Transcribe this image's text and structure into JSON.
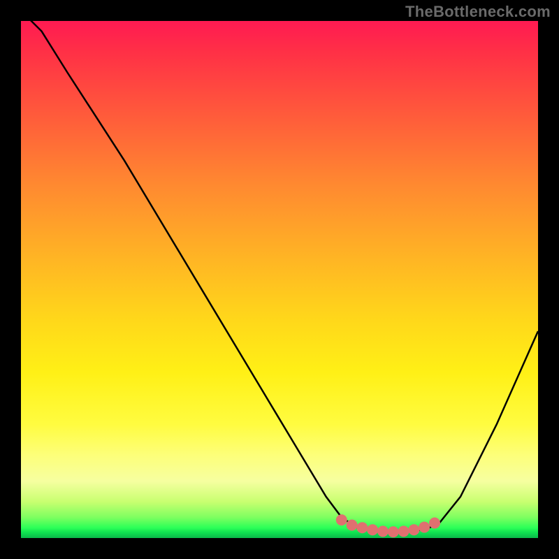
{
  "watermark": "TheBottleneck.com",
  "chart_data": {
    "type": "line",
    "title": "",
    "xlabel": "",
    "ylabel": "",
    "xlim": [
      0,
      100
    ],
    "ylim": [
      0,
      100
    ],
    "grid": false,
    "legend": false,
    "curve": {
      "x": [
        0,
        4,
        9,
        20,
        35,
        50,
        59,
        62,
        65,
        68,
        72,
        76,
        79,
        81,
        85,
        92,
        100
      ],
      "y": [
        102,
        98,
        90,
        73,
        48,
        23,
        8,
        4,
        2,
        1.5,
        1.2,
        1.3,
        2,
        3,
        8,
        22,
        40
      ],
      "note": "y = bottleneck percentage; 0 is best (bottom), 100 is worst (top); optimum trough ~x=68-76"
    },
    "markers": {
      "x": [
        62,
        64,
        66,
        68,
        70,
        72,
        74,
        76,
        78,
        80
      ],
      "y": [
        3.5,
        2.5,
        2.0,
        1.6,
        1.3,
        1.2,
        1.3,
        1.6,
        2.1,
        2.9
      ],
      "color": "#e07070",
      "size": 8
    },
    "colors": {
      "curve_stroke": "#000000",
      "marker_fill": "#e07070",
      "gradient_top": "#ff1a52",
      "gradient_bottom": "#0bb84a",
      "background_frame": "#000000",
      "watermark_text": "#6a6a6a"
    }
  }
}
